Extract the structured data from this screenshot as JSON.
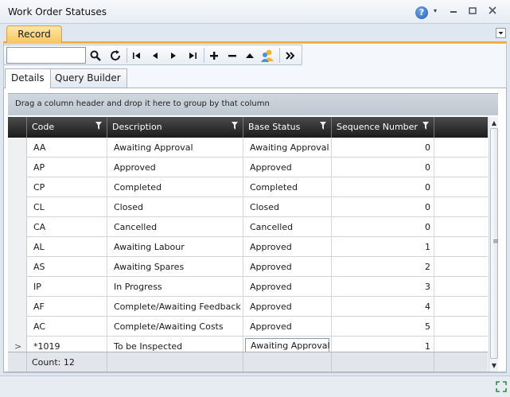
{
  "window": {
    "title": "Work Order Statuses",
    "help_glyph": "?",
    "menu_arrow": "▾",
    "minimize_glyph": "▭",
    "restore_glyph": "❐",
    "close_glyph": "✕"
  },
  "record_tab": {
    "label": "Record",
    "dropdown_glyph": "▾"
  },
  "toolbar": {
    "search_value": "",
    "search_placeholder": "",
    "icons": [
      "search-icon",
      "refresh-icon",
      "first-record-icon",
      "previous-record-icon",
      "next-record-icon",
      "last-record-icon",
      "add-icon",
      "delete-icon",
      "move-up-icon",
      "users-icon",
      "more-icon"
    ],
    "glyphs": {
      "search": "🔍",
      "refresh": "↻",
      "first": "|◂",
      "prev": "◂",
      "next": "▸",
      "last": "▸|",
      "add": "+",
      "delete": "−",
      "up": "▲",
      "more": "»"
    }
  },
  "tabs": [
    {
      "label": "Details",
      "active": true
    },
    {
      "label": "Query Builder",
      "active": false
    }
  ],
  "group_panel": {
    "text": "Drag a column header and drop it here to group by that column"
  },
  "grid": {
    "columns": [
      "Code",
      "Description",
      "Base Status",
      "Sequence Number"
    ],
    "rows": [
      {
        "code": "AA",
        "description": "Awaiting Approval",
        "base_status": "Awaiting Approval",
        "sequence": "0"
      },
      {
        "code": "AP",
        "description": "Approved",
        "base_status": "Approved",
        "sequence": "0"
      },
      {
        "code": "CP",
        "description": "Completed",
        "base_status": "Completed",
        "sequence": "0"
      },
      {
        "code": "CL",
        "description": "Closed",
        "base_status": "Closed",
        "sequence": "0"
      },
      {
        "code": "CA",
        "description": "Cancelled",
        "base_status": "Cancelled",
        "sequence": "0"
      },
      {
        "code": "AL",
        "description": "Awaiting Labour",
        "base_status": "Approved",
        "sequence": "1"
      },
      {
        "code": "AS",
        "description": "Awaiting Spares",
        "base_status": "Approved",
        "sequence": "2"
      },
      {
        "code": "IP",
        "description": "In Progress",
        "base_status": "Approved",
        "sequence": "3"
      },
      {
        "code": "AF",
        "description": "Complete/Awaiting Feedback",
        "base_status": "Approved",
        "sequence": "4"
      },
      {
        "code": "AC",
        "description": "Complete/Awaiting Costs",
        "base_status": "Approved",
        "sequence": "5"
      },
      {
        "code": "*1019",
        "description": "To be Inspected",
        "base_status": "Awaiting Approval",
        "sequence": "1",
        "current": true
      }
    ],
    "current_row_indicator": ">",
    "footer": {
      "count_label": "Count: 12"
    }
  },
  "colors": {
    "accent_tab": "#f8c55c",
    "header_bg": "#2a2a2a",
    "help_icon": "#1f5fb5"
  }
}
